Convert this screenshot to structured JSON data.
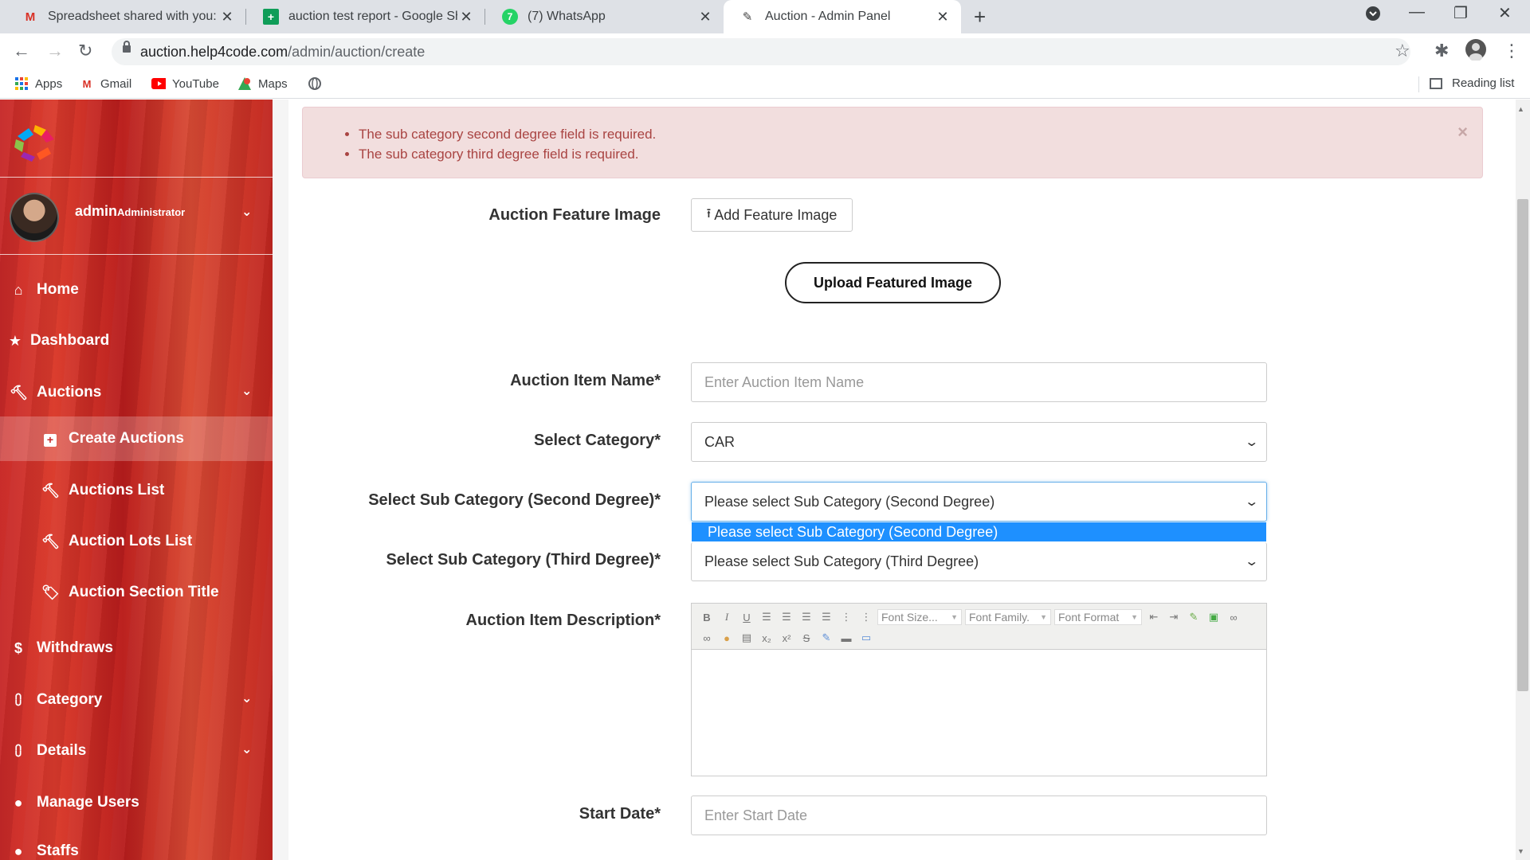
{
  "browser": {
    "tabs": [
      {
        "title": "Spreadsheet shared with you: \"au",
        "icon": "gmail-icon"
      },
      {
        "title": "auction test report - Google Shee",
        "icon": "sheets-icon"
      },
      {
        "title": "(7) WhatsApp",
        "icon": "whatsapp-icon"
      },
      {
        "title": "Auction - Admin Panel",
        "icon": "auction-favicon"
      }
    ],
    "url_host": "auction.help4code.com",
    "url_path": "/admin/auction/create",
    "bookmarks": [
      {
        "label": "Apps"
      },
      {
        "label": "Gmail"
      },
      {
        "label": "YouTube"
      },
      {
        "label": "Maps"
      }
    ],
    "reading_list": "Reading list"
  },
  "sidebar": {
    "user_name": "admin",
    "user_role": "Administrator",
    "items": [
      {
        "label": "Home",
        "icon": "home-icon"
      },
      {
        "label": "Dashboard",
        "icon": "star-icon"
      },
      {
        "label": "Auctions",
        "icon": "gavel-icon"
      },
      {
        "label": "Create Auctions",
        "icon": "plus-square-icon"
      },
      {
        "label": "Auctions List",
        "icon": "gavel-icon"
      },
      {
        "label": "Auction Lots List",
        "icon": "gavel-icon"
      },
      {
        "label": "Auction Section Title",
        "icon": "tag-icon"
      },
      {
        "label": "Withdraws",
        "icon": "dollar-icon"
      },
      {
        "label": "Category",
        "icon": "sitemap-icon"
      },
      {
        "label": "Details",
        "icon": "sitemap-icon"
      },
      {
        "label": "Manage Users",
        "icon": "user-icon"
      },
      {
        "label": "Staffs",
        "icon": "users-icon"
      }
    ]
  },
  "alert": {
    "errors": [
      "The sub category second degree field is required.",
      "The sub category third degree field is required."
    ],
    "close": "×"
  },
  "form": {
    "feature_image_label": "Auction Feature Image",
    "add_feature_image": "Add Feature Image",
    "upload_featured_image": "Upload Featured Image",
    "item_name_label": "Auction Item Name*",
    "item_name_placeholder": "Enter Auction Item Name",
    "category_label": "Select Category*",
    "category_value": "CAR",
    "sub2_label": "Select Sub Category (Second Degree)*",
    "sub2_value": "Please select Sub Category (Second Degree)",
    "sub2_option_highlighted": "Please select Sub Category (Second Degree)",
    "sub3_label": "Select Sub Category (Third Degree)*",
    "sub3_value": "Please select Sub Category (Third Degree)",
    "description_label": "Auction Item Description*",
    "editor_selects": [
      "Font Size...",
      "Font Family.",
      "Font Format"
    ],
    "start_date_label": "Start Date*",
    "start_date_placeholder": "Enter Start Date"
  },
  "colors": {
    "sidebar_red": "#c62828",
    "alert_bg": "#f2dede",
    "alert_text": "#a94442",
    "option_highlight": "#1e90ff"
  }
}
